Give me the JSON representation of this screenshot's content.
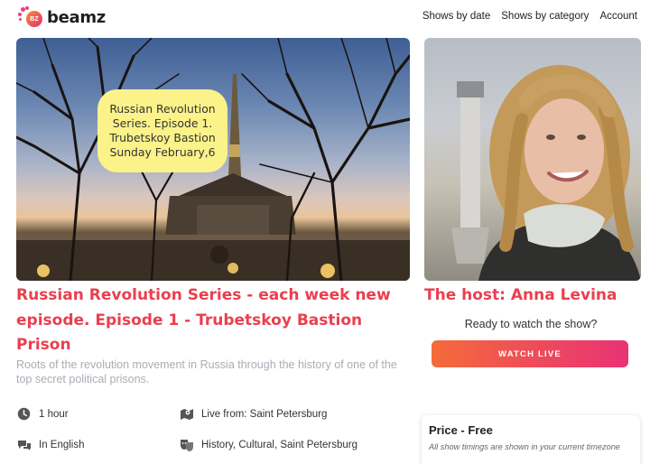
{
  "brand": {
    "logo_badge": "BZ",
    "logo_text": "beamz"
  },
  "nav": {
    "items": [
      "Shows by date",
      "Shows by category",
      "Account"
    ]
  },
  "hero": {
    "bubble_lines": [
      "Russian Revolution",
      "Series. Episode 1.",
      "Trubetskoy Bastion",
      "Sunday February,6"
    ]
  },
  "show": {
    "title": "Russian Revolution Series - each week new episode. Episode 1 - Trubetskoy Bastion Prison",
    "description": "Roots of the revolution movement in Russia through the history of one of the top secret political prisons.",
    "details": {
      "duration": "1 hour",
      "location": "Live from: Saint Petersburg",
      "language": "In English",
      "categories": "History, Cultural, Saint Petersburg"
    }
  },
  "host": {
    "title": "The host: Anna Levina"
  },
  "booking": {
    "ready_text": "Ready to watch the show?",
    "watch_label": "WATCH LIVE",
    "price_title": "Price - Free",
    "price_note": "All show timings are shown in your current timezone"
  },
  "colors": {
    "accent": "#ea3f4f",
    "button_start": "#f46b3a",
    "button_end": "#e93275",
    "description": "#a9adb5"
  }
}
